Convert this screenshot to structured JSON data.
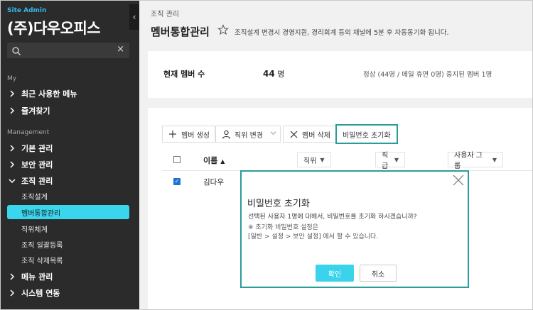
{
  "sidebar": {
    "site_label": "Site Admin",
    "company": "(주)다우오피스",
    "search": {
      "value": "",
      "clear_glyph": "×"
    },
    "collapse_glyph": "‹",
    "sections": {
      "my": "My",
      "management": "Management"
    },
    "my_items": [
      {
        "label": "최근 사용한 메뉴",
        "icon": "chevron-right-icon"
      },
      {
        "label": "즐겨찾기",
        "icon": "chevron-right-icon"
      }
    ],
    "mgmt_items": [
      {
        "label": "기본 관리",
        "icon": "chevron-right-icon"
      },
      {
        "label": "보안 관리",
        "icon": "chevron-right-icon"
      },
      {
        "label": "조직 관리",
        "icon": "chevron-down-icon"
      }
    ],
    "org_sub_items": [
      {
        "label": "조직설계",
        "active": false
      },
      {
        "label": "멤버통합관리",
        "active": true
      },
      {
        "label": "직위체계",
        "active": false
      },
      {
        "label": "조직 일괄등록",
        "active": false
      },
      {
        "label": "조직 삭제목록",
        "active": false
      }
    ],
    "after_items": [
      {
        "label": "메뉴 관리",
        "icon": "chevron-right-icon"
      },
      {
        "label": "시스템 연동",
        "icon": "chevron-right-icon"
      }
    ],
    "colors": {
      "background": "#2b2b2b",
      "active": "#3ad6ee",
      "site_label": "#35b6e6"
    }
  },
  "header": {
    "breadcrumb": "조직 관리",
    "title": "멤버통합관리",
    "description": "조직설계 변경시 경영지원, 경리회계 등의 채널에 5분 후 자동동기화 됩니다."
  },
  "summary": {
    "label": "현재 멤버 수",
    "count": "44",
    "unit": "명",
    "detail": "정상 (44명 / 메일 휴면 0명) 중지된 멤버 1명"
  },
  "toolbar": {
    "create": "멤버 생성",
    "change_position": "직위 변경",
    "delete": "멤버 삭제",
    "reset_password": "비밀번호 초기화"
  },
  "table": {
    "columns": {
      "name": "이름",
      "name_sort": "▲",
      "position": "직위",
      "rank": "직급",
      "user_group": "사용자 그룹",
      "dropdown_glyph": "▼"
    },
    "rows": [
      {
        "name": "김다우",
        "checked": true
      }
    ]
  },
  "dialog": {
    "title": "비밀번호 초기화",
    "message": "선택된 사용자 1명에 대해서, 비밀번호를 초기화 하시겠습니까?",
    "note1": "※ 초기화 비밀번호 설정은",
    "note2": "[일반 > 설정 > 보안 설정] 에서 할 수 있습니다.",
    "confirm": "확인",
    "cancel": "취소",
    "colors": {
      "border": "#2a9d9a",
      "confirm": "#3ad3eb"
    }
  }
}
